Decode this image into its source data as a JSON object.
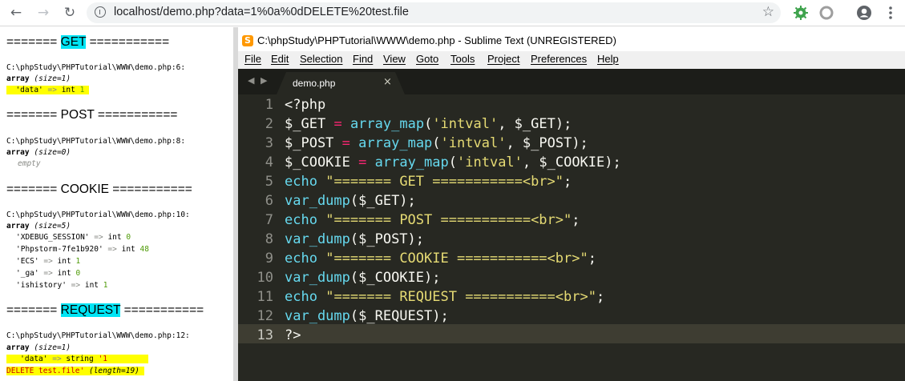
{
  "browser": {
    "back_icon": "←",
    "forward_icon": "→",
    "reload_icon": "↻",
    "url": "localhost/demo.php?data=1%0a%0dDELETE%20test.file",
    "star_icon": "☆"
  },
  "page": {
    "get": {
      "header_prefix": "======= ",
      "header_word": "GET",
      "header_suffix": " ===========",
      "path": "C:\\phpStudy\\PHPTutorial\\WWW\\demo.php:6:",
      "type": "array",
      "size": "(size=1)",
      "entry_key": "'data'",
      "entry_arrow": "=>",
      "entry_type": "int",
      "entry_value": "1"
    },
    "post": {
      "header": "======= POST ===========",
      "path": "C:\\phpStudy\\PHPTutorial\\WWW\\demo.php:8:",
      "type": "array",
      "size": "(size=0)",
      "empty": "empty"
    },
    "cookie": {
      "header": "======= COOKIE ===========",
      "path": "C:\\phpStudy\\PHPTutorial\\WWW\\demo.php:10:",
      "type": "array",
      "size": "(size=5)",
      "entries": [
        {
          "key": "'XDEBUG_SESSION'",
          "arrow": "=>",
          "type": "int",
          "value": "0"
        },
        {
          "key": "'Phpstorm-7fe1b920'",
          "arrow": "=>",
          "type": "int",
          "value": "48"
        },
        {
          "key": "'ECS'",
          "arrow": "=>",
          "type": "int",
          "value": "1"
        },
        {
          "key": "'_ga'",
          "arrow": "=>",
          "type": "int",
          "value": "0"
        },
        {
          "key": "'ishistory'",
          "arrow": "=>",
          "type": "int",
          "value": "1"
        }
      ]
    },
    "request": {
      "header_prefix": "======= ",
      "header_word": "REQUEST",
      "header_suffix": " ===========",
      "path": "C:\\phpStudy\\PHPTutorial\\WWW\\demo.php:12:",
      "type": "array",
      "size": "(size=1)",
      "entry_key": "'data'",
      "entry_arrow": "=>",
      "entry_type": "string",
      "entry_value_line1": "'1",
      "entry_value_line2": "DELETE test.file'",
      "entry_length": "(length=19)"
    }
  },
  "sublime": {
    "logo": "S",
    "title": "C:\\phpStudy\\PHPTutorial\\WWW\\demo.php - Sublime Text (UNREGISTERED)",
    "menu": [
      "File",
      "Edit",
      "Selection",
      "Find",
      "View",
      "Goto",
      "Tools",
      "Project",
      "Preferences",
      "Help"
    ],
    "tab_arrows": "◀ ▶",
    "tab_name": "demo.php",
    "tab_close": "×",
    "line_numbers": [
      "1",
      "2",
      "3",
      "4",
      "5",
      "6",
      "7",
      "8",
      "9",
      "10",
      "11",
      "12",
      "13"
    ],
    "code": {
      "l1": "<?php",
      "l2_var": "$_GET",
      "l2_op": "=",
      "l2_fn": "array_map",
      "l2_open": "(",
      "l2_str": "'intval'",
      "l2_rest": ", $_GET);",
      "l3_var": "$_POST",
      "l3_op": "=",
      "l3_fn": "array_map",
      "l3_open": "(",
      "l3_str": "'intval'",
      "l3_rest": ", $_POST);",
      "l4_var": "$_COOKIE",
      "l4_op": "=",
      "l4_fn": "array_map",
      "l4_open": "(",
      "l4_str": "'intval'",
      "l4_rest": ", $_COOKIE);",
      "l5_kw": "echo",
      "l5_str": "\"======= GET ===========<br>\"",
      "l5_end": ";",
      "l6_fn": "var_dump",
      "l6_rest": "($_GET);",
      "l7_kw": "echo",
      "l7_str": "\"======= POST ===========<br>\"",
      "l7_end": ";",
      "l8_fn": "var_dump",
      "l8_rest": "($_POST);",
      "l9_kw": "echo",
      "l9_str": "\"======= COOKIE ===========<br>\"",
      "l9_end": ";",
      "l10_fn": "var_dump",
      "l10_rest": "($_COOKIE);",
      "l11_kw": "echo",
      "l11_str": "\"======= REQUEST ===========<br>\"",
      "l11_end": ";",
      "l12_fn": "var_dump",
      "l12_rest": "($_REQUEST);",
      "l13": "?>"
    }
  }
}
